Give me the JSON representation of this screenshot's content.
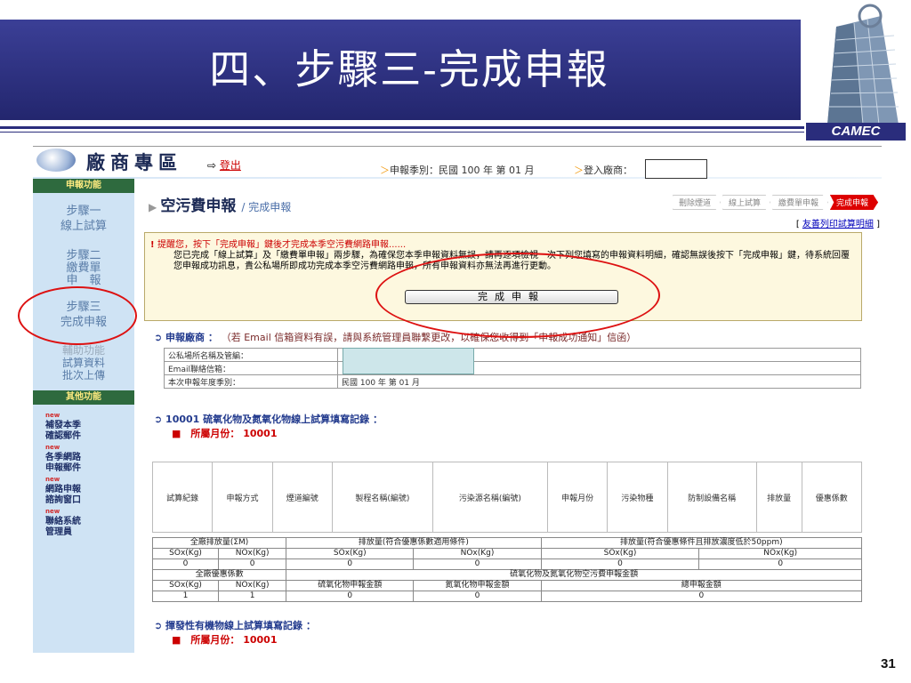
{
  "slide": {
    "title": "四、步驟三-完成申報",
    "logo_text": "CAMEC",
    "page_number": "31"
  },
  "topbar": {
    "brand": "廠商專區",
    "logout": "登出",
    "period": "申報季別：民國 100 年 第 01 月",
    "login_label": "登入廠商："
  },
  "sidebar": {
    "head1": "申報功能",
    "step1": [
      "步驟一",
      "線上試算"
    ],
    "step2": [
      "步驟二",
      "繳費單",
      "申　報"
    ],
    "step3": [
      "步驟三",
      "完成申報"
    ],
    "aux": [
      "輔助功能",
      "試算資料",
      "批次上傳"
    ],
    "head2": "其他功能",
    "links": [
      {
        "tag": "new",
        "label": [
          "補發本季",
          "確認郵件"
        ]
      },
      {
        "tag": "new",
        "label": [
          "各季網路",
          "申報郵件"
        ]
      },
      {
        "tag": "new",
        "label": [
          "網路申報",
          "諮詢窗口"
        ]
      },
      {
        "tag": "new",
        "label": [
          "聯絡系統",
          "管理員"
        ]
      }
    ]
  },
  "main": {
    "title": "空污費申報",
    "subtitle": "/ 完成申報",
    "steps": [
      "刪除煙道",
      "線上試算",
      "繳費單申報",
      "完成申報"
    ],
    "print_link": "友善列印試算明細",
    "notice_title": "提醒您，按下「完成申報」鍵後才完成本季空污費網路申報......",
    "notice_body": "您已完成「線上試算」及「繳費單申報」兩步驟，為確保您本季申報資料無誤，請再逐項檢視一次下列您填寫的申報資料明細，確認無誤後按下「完成申報」鍵，待系統回覆您申報成功訊息，貴公私場所即成功完成本季空污費網路申報，所有申報資料亦無法再進行更動。",
    "submit_button": "完成申報",
    "sec1_title": "申報廠商 ：",
    "sec1_note": "（若 Email 信箱資料有誤，請與系統管理員聯繫更改，以確保您收得到「申報成功通知」信函）",
    "info_rows": [
      {
        "label": "公私場所名稱及管編：",
        "value": ""
      },
      {
        "label": "Email聯絡信箱：",
        "value": ""
      },
      {
        "label": "本次申報年度季別：",
        "value": "民國 100 年 第 01 月"
      }
    ],
    "sec2_title": "10001 硫氧化物及氮氧化物線上試算填寫記錄 ：",
    "sec2_month": "■　所屬月份： 10001",
    "grid1_headers": [
      "試算紀錄",
      "申報方式",
      "煙道編號",
      "製程名稱(編號)",
      "污染源名稱(編號)",
      "申報月份",
      "污染物種",
      "防制設備名稱",
      "排放量",
      "優惠係數"
    ],
    "grid2": {
      "h_total": "全廠排放量(ΣM)",
      "h_discount": "排放量(符合優惠係數適用條件)",
      "h_cond": "排放量(符合優惠條件且排放濃度低於50ppm)",
      "sox": "SOx(Kg)",
      "nox": "NOx(Kg)",
      "row_vals": [
        "0",
        "0",
        "0",
        "0",
        "0",
        "0"
      ],
      "h_factor": "全廠優惠係數",
      "h_fee": "硫氧化物及氮氧化物空污費申報金額",
      "sox_fee": "硫氧化物申報金額",
      "nox_fee": "氮氧化物申報金額",
      "total_fee": "總申報金額",
      "fee_vals": [
        "1",
        "1",
        "0",
        "0",
        "0"
      ]
    },
    "sec3_title": "揮發性有機物線上試算填寫記錄 ：",
    "sec3_month": "■　所屬月份： 10001"
  }
}
